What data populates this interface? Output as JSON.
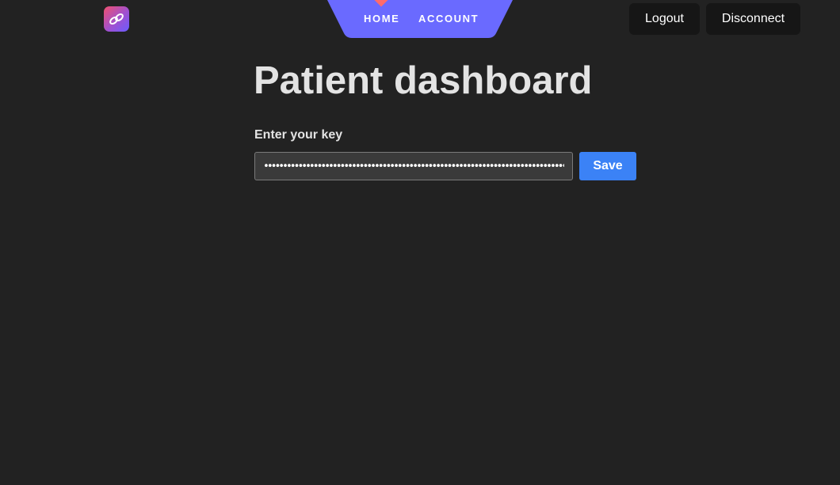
{
  "header": {
    "logo_icon": "link-logo-icon",
    "nav": {
      "home_label": "HOME",
      "account_label": "ACCOUNT",
      "active": "home",
      "background_color": "#6a6aff",
      "indicator_color": "#ff6b6b"
    },
    "logout_label": "Logout",
    "disconnect_label": "Disconnect"
  },
  "main": {
    "title": "Patient dashboard",
    "key_label": "Enter your key",
    "key_input_value": "••••••••••••••••••••••••••••••••••••••••••••••••••••••••••••••••••••••••••••••••••",
    "save_label": "Save",
    "save_color": "#3b82f6"
  }
}
